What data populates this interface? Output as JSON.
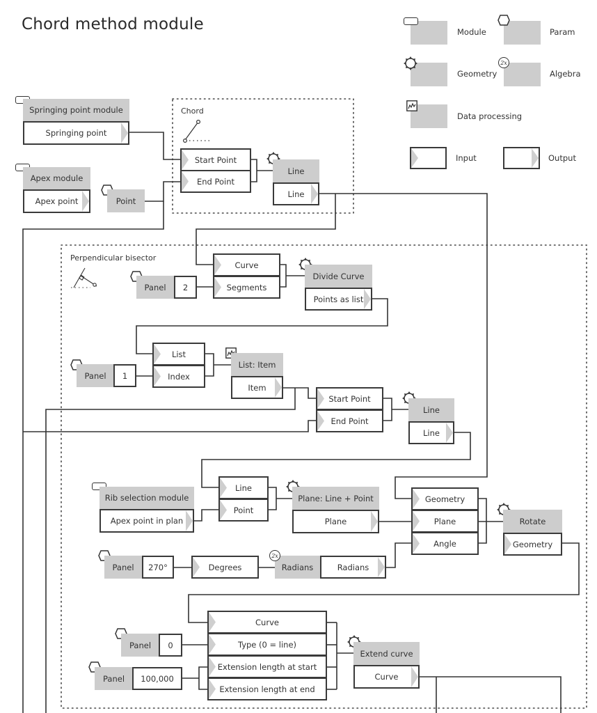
{
  "title": "Chord method module",
  "legend": {
    "module": "Module",
    "param": "Param",
    "geometry": "Geometry",
    "algebra": "Algebra",
    "algebra_icon_text": "2x",
    "data_processing": "Data processing",
    "input": "Input",
    "output": "Output"
  },
  "regions": {
    "chord": "Chord",
    "bisector": "Perpendicular bisector"
  },
  "nodes": {
    "springing_module": {
      "header": "Springing point module",
      "output": "Springing point"
    },
    "apex_module": {
      "header": "Apex module",
      "output": "Apex point"
    },
    "point_param": {
      "header": "Point"
    },
    "chord_inputs": {
      "start": "Start Point",
      "end": "End Point"
    },
    "chord_line": {
      "header": "Line",
      "output": "Line"
    },
    "panel_2": {
      "header": "Panel",
      "value": "2"
    },
    "divide_inputs": {
      "curve": "Curve",
      "segments": "Segments"
    },
    "divide_curve": {
      "header": "Divide Curve",
      "output": "Points as list"
    },
    "panel_1": {
      "header": "Panel",
      "value": "1"
    },
    "list_inputs": {
      "list": "List",
      "index": "Index"
    },
    "list_item": {
      "header": "List: Item",
      "output": "Item"
    },
    "bisector_inputs": {
      "start": "Start Point",
      "end": "End Point"
    },
    "bisector_line": {
      "header": "Line",
      "output": "Line"
    },
    "rib_module": {
      "header": "Rib selection module",
      "output": "Apex point in plan"
    },
    "plane_inputs": {
      "line": "Line",
      "point": "Point"
    },
    "plane_node": {
      "header": "Plane: Line + Point",
      "output": "Plane"
    },
    "panel_270": {
      "header": "Panel",
      "value": "270°"
    },
    "degrees": {
      "input": "Degrees"
    },
    "radians": {
      "header": "Radians",
      "output": "Radians"
    },
    "rotate_inputs": {
      "geometry": "Geometry",
      "plane": "Plane",
      "angle": "Angle"
    },
    "rotate": {
      "header": "Rotate",
      "output": "Geometry"
    },
    "panel_0": {
      "header": "Panel",
      "value": "0"
    },
    "panel_100000": {
      "header": "Panel",
      "value": "100,000"
    },
    "extend_inputs": {
      "curve": "Curve",
      "type": "Type  (0 = line)",
      "start": "Extension length at start",
      "end": "Extension length at end"
    },
    "extend_curve": {
      "header": "Extend curve",
      "output": "Curve"
    }
  }
}
